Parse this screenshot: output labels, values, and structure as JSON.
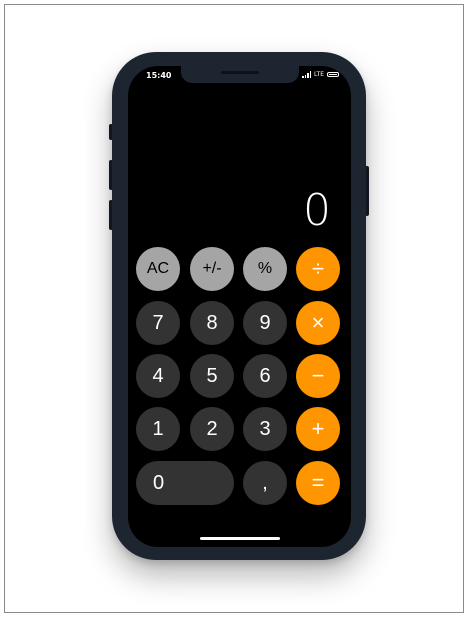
{
  "status_bar": {
    "time": "15:40",
    "carrier": "LTE"
  },
  "display": {
    "value": "0"
  },
  "keypad": {
    "row1": [
      "AC",
      "+/-",
      "%",
      "÷"
    ],
    "row2": [
      "7",
      "8",
      "9",
      "×"
    ],
    "row3": [
      "4",
      "5",
      "6",
      "−"
    ],
    "row4": [
      "1",
      "2",
      "3",
      "+"
    ],
    "row5": [
      "0",
      ",",
      "="
    ]
  },
  "colors": {
    "function_key": "#a5a5a5",
    "digit_key": "#333333",
    "operator_key": "#ff9500",
    "screen": "#000000",
    "phone_body": "#1d2531"
  }
}
